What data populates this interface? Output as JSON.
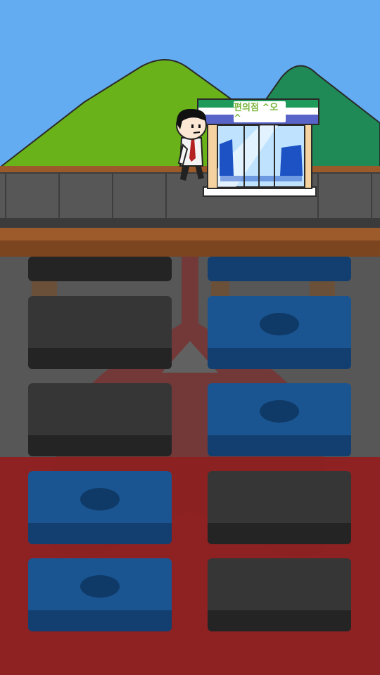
{
  "game": {
    "store_sign": "편의점 ^오^"
  },
  "tiles": [
    {
      "id": "r1-left",
      "color": "dark",
      "marked": false
    },
    {
      "id": "r1-right",
      "color": "blue",
      "marked": false
    },
    {
      "id": "r2-left",
      "color": "dark",
      "marked": false
    },
    {
      "id": "r2-right",
      "color": "blue",
      "marked": true
    },
    {
      "id": "r3-left",
      "color": "dark",
      "marked": false
    },
    {
      "id": "r3-right",
      "color": "blue",
      "marked": true
    },
    {
      "id": "r4-left",
      "color": "blue",
      "marked": true
    },
    {
      "id": "r4-right",
      "color": "dark",
      "marked": false
    },
    {
      "id": "r5-left",
      "color": "blue",
      "marked": true
    },
    {
      "id": "r5-right",
      "color": "dark",
      "marked": false
    }
  ],
  "colors": {
    "sky": "#64acf1",
    "tile_dark": "#363636",
    "tile_blue": "#1a5591",
    "danger_zone": "#8e2222"
  }
}
